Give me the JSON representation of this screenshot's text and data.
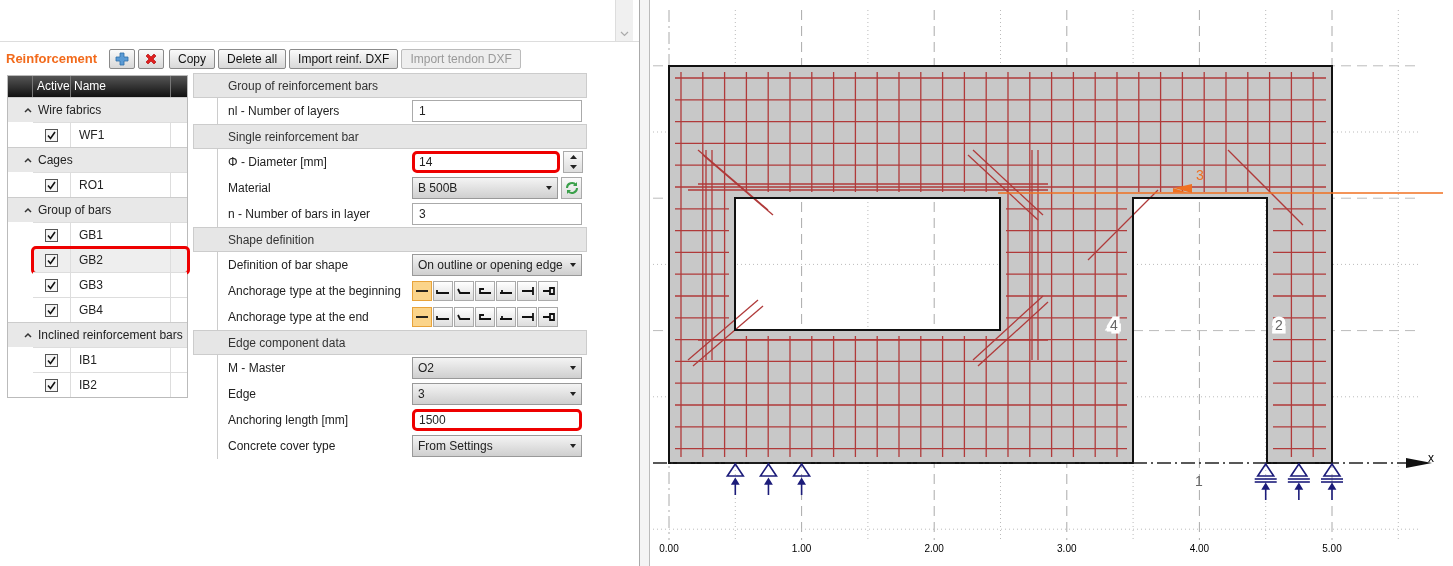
{
  "panel": {
    "title": "Reinforcement"
  },
  "toolbar": {
    "icon_buttons": [
      {
        "kind": "add"
      },
      {
        "kind": "delete"
      }
    ],
    "buttons": [
      {
        "label": "Copy",
        "disabled": false
      },
      {
        "label": "Delete all",
        "disabled": false
      },
      {
        "label": "Import reinf. DXF",
        "disabled": false
      },
      {
        "label": "Import tendon DXF",
        "disabled": true
      }
    ]
  },
  "tree": {
    "columns": [
      "Active",
      "Name"
    ],
    "groups": [
      {
        "label": "Wire fabrics",
        "expanded": true,
        "items": [
          {
            "name": "WF1",
            "checked": true,
            "selected": false,
            "highlighted": false
          }
        ]
      },
      {
        "label": "Cages",
        "expanded": true,
        "items": [
          {
            "name": "RO1",
            "checked": true,
            "selected": false,
            "highlighted": false
          }
        ]
      },
      {
        "label": "Group of bars",
        "expanded": true,
        "items": [
          {
            "name": "GB1",
            "checked": true,
            "selected": false,
            "highlighted": false
          },
          {
            "name": "GB2",
            "checked": true,
            "selected": true,
            "highlighted": true
          },
          {
            "name": "GB3",
            "checked": true,
            "selected": false,
            "highlighted": false
          },
          {
            "name": "GB4",
            "checked": true,
            "selected": false,
            "highlighted": false
          }
        ]
      },
      {
        "label": "Inclined reinforcement bars",
        "expanded": true,
        "items": [
          {
            "name": "IB1",
            "checked": true,
            "selected": false,
            "highlighted": false
          },
          {
            "name": "IB2",
            "checked": true,
            "selected": false,
            "highlighted": false
          }
        ]
      }
    ]
  },
  "properties": {
    "sections": [
      {
        "title": "Group of reinforcement bars",
        "rows": [
          {
            "kind": "text",
            "label": "nl - Number of layers",
            "value": "1",
            "highlighted": false
          }
        ]
      },
      {
        "title": "Single reinforcement bar",
        "rows": [
          {
            "kind": "spin",
            "label": "Φ - Diameter [mm]",
            "value": "14",
            "highlighted": true
          },
          {
            "kind": "select-refresh",
            "label": "Material",
            "value": "B 500B",
            "highlighted": false
          },
          {
            "kind": "text",
            "label": "n - Number of bars in layer",
            "value": "3",
            "highlighted": false
          }
        ]
      },
      {
        "title": "Shape definition",
        "rows": [
          {
            "kind": "select",
            "label": "Definition of bar shape",
            "value": "On outline or opening edge",
            "highlighted": false
          },
          {
            "kind": "anchorage",
            "label": "Anchorage type at the beginning",
            "options": [
              {
                "kind": "straight",
                "selected": true
              },
              {
                "kind": "hook90",
                "selected": false
              },
              {
                "kind": "hook135",
                "selected": false
              },
              {
                "kind": "hook180",
                "selected": false
              },
              {
                "kind": "plate",
                "selected": false
              },
              {
                "kind": "weld",
                "selected": false
              },
              {
                "kind": "loop",
                "selected": false
              }
            ]
          },
          {
            "kind": "anchorage",
            "label": "Anchorage type at the end",
            "options": [
              {
                "kind": "straight",
                "selected": true
              },
              {
                "kind": "hook90",
                "selected": false
              },
              {
                "kind": "hook135",
                "selected": false
              },
              {
                "kind": "hook180",
                "selected": false
              },
              {
                "kind": "plate",
                "selected": false
              },
              {
                "kind": "weld",
                "selected": false
              },
              {
                "kind": "loop",
                "selected": false
              }
            ]
          }
        ]
      },
      {
        "title": "Edge component data",
        "rows": [
          {
            "kind": "select",
            "label": "M - Master",
            "value": "O2",
            "highlighted": false
          },
          {
            "kind": "select",
            "label": "Edge",
            "value": "3",
            "highlighted": false
          },
          {
            "kind": "text",
            "label": "Anchoring length [mm]",
            "value": "1500",
            "highlighted": true
          },
          {
            "kind": "select",
            "label": "Concrete cover type",
            "value": "From Settings",
            "highlighted": false
          }
        ]
      }
    ]
  },
  "canvas": {
    "x_ticks": [
      "0.00",
      "1.00",
      "2.00",
      "3.00",
      "4.00",
      "5.00"
    ],
    "edge_labels": [
      {
        "label": "1",
        "selected": false
      },
      {
        "label": "2",
        "selected": false
      },
      {
        "label": "3",
        "selected": true
      },
      {
        "label": "4",
        "selected": false
      }
    ],
    "axis_label": "x"
  }
}
